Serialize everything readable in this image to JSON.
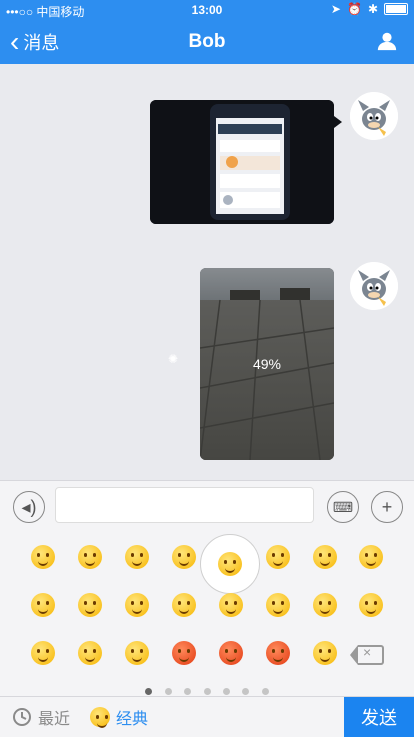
{
  "status_bar": {
    "carrier": "•••○○ 中国移动",
    "time": "13:00"
  },
  "nav": {
    "back_label": "消息",
    "title": "Bob"
  },
  "messages": [
    {
      "type": "image",
      "description": "phone screenshot image"
    },
    {
      "type": "image",
      "progress_text": "49%",
      "progress_value": 49
    }
  ],
  "input": {
    "placeholder": ""
  },
  "bottom_bar": {
    "recent_label": "最近",
    "classic_label": "经典",
    "send_label": "发送"
  },
  "emoji_pages": {
    "total": 7,
    "active": 0
  },
  "colors": {
    "nav": "#2d8ef0",
    "send": "#1b84f0"
  }
}
